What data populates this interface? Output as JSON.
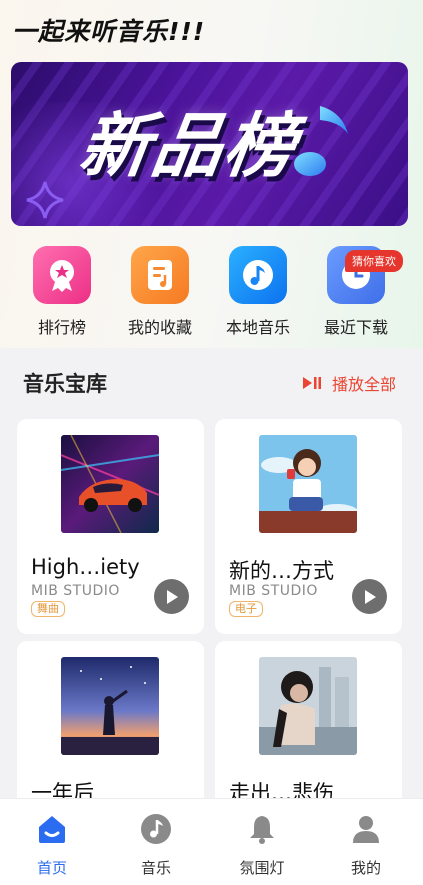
{
  "app": {
    "title": "一起来听音乐!!!"
  },
  "banner": {
    "text": "新品榜"
  },
  "quick_access": {
    "items": [
      {
        "label": "排行榜",
        "icon": "ranking-icon",
        "color": "#f0498f"
      },
      {
        "label": "我的收藏",
        "icon": "favorites-icon",
        "color": "#f58a32"
      },
      {
        "label": "本地音乐",
        "icon": "local-music-icon",
        "color": "#1a86f5"
      },
      {
        "label": "最近下载",
        "icon": "clock-icon",
        "color": "#4a7ef0"
      }
    ],
    "badge": "猜你喜欢"
  },
  "library": {
    "title": "音乐宝库",
    "play_all": "播放全部",
    "cards": [
      {
        "title": "High…iety",
        "artist": "MIB STUDIO",
        "tag": "舞曲"
      },
      {
        "title": "新的…方式",
        "artist": "MIB STUDIO",
        "tag": "电子"
      },
      {
        "title": "一年后",
        "artist": "",
        "tag": ""
      },
      {
        "title": "走出…悲伤",
        "artist": "",
        "tag": ""
      }
    ]
  },
  "bottom_nav": {
    "items": [
      {
        "label": "首页",
        "icon": "home-icon",
        "active": true
      },
      {
        "label": "音乐",
        "icon": "music-note-icon",
        "active": false
      },
      {
        "label": "氛围灯",
        "icon": "bell-icon",
        "active": false
      },
      {
        "label": "我的",
        "icon": "profile-icon",
        "active": false
      }
    ]
  },
  "colors": {
    "accent": "#2c6cf0",
    "play_all": "#ea4432",
    "tag": "#e39a3d",
    "badge": "#e5352d"
  }
}
